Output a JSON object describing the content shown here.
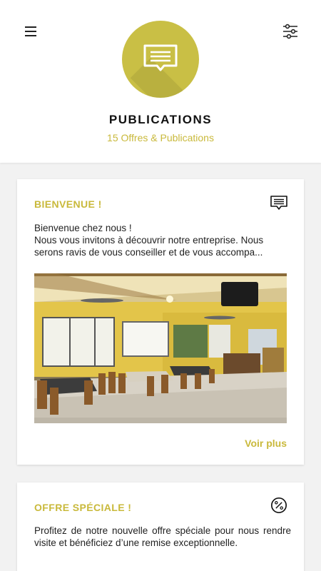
{
  "header": {
    "title": "PUBLICATIONS",
    "subtitle": "15 Offres & Publications"
  },
  "icons": {
    "menu": "hamburger-menu-icon",
    "filter": "sliders-filter-icon",
    "hero": "chat-message-icon",
    "card_message": "message-icon",
    "card_percent": "percent-icon"
  },
  "colors": {
    "accent": "#c9bf45",
    "accent_text": "#c9b93b",
    "background": "#f2f2f2"
  },
  "posts": [
    {
      "title": "BIENVENUE !",
      "line1": "Bienvenue chez nous !",
      "line2": "Nous vous invitons à découvrir notre entreprise. Nous",
      "line3": "serons ravis de vous conseiller et de vous accompa...",
      "link": "Voir plus"
    },
    {
      "title": "OFFRE SPÉCIALE !",
      "body": "Profitez de notre nouvelle offre spéciale pour nous rendre visite et bénéficiez d’une remise exceptionnelle."
    }
  ]
}
